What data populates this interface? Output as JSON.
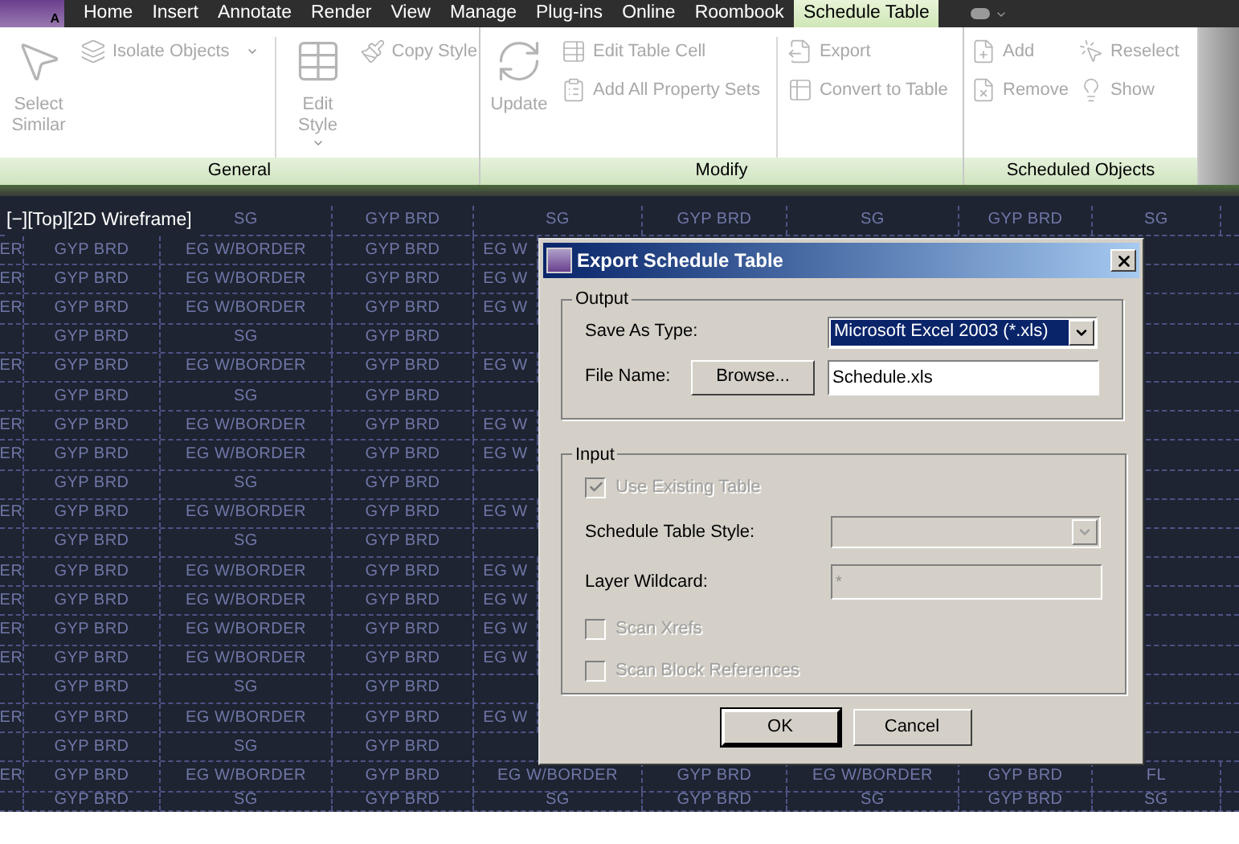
{
  "app_button": {
    "letter": "A"
  },
  "tabs": [
    {
      "label": "Home",
      "selected": false
    },
    {
      "label": "Insert",
      "selected": false
    },
    {
      "label": "Annotate",
      "selected": false
    },
    {
      "label": "Render",
      "selected": false
    },
    {
      "label": "View",
      "selected": false
    },
    {
      "label": "Manage",
      "selected": false
    },
    {
      "label": "Plug-ins",
      "selected": false
    },
    {
      "label": "Online",
      "selected": false
    },
    {
      "label": "Roombook",
      "selected": false
    },
    {
      "label": "Schedule Table",
      "selected": true
    }
  ],
  "ribbon": {
    "panels": [
      {
        "title": "General",
        "groups": [
          {
            "kind": "large",
            "separator_after": false,
            "items": [
              {
                "label": "Select Similar",
                "dropdown": false,
                "disabled": true
              }
            ]
          },
          {
            "kind": "small",
            "separator_after": true,
            "items": [
              {
                "label": "Isolate Objects",
                "dropdown": true,
                "disabled": true
              }
            ]
          },
          {
            "kind": "large",
            "separator_after": false,
            "items": [
              {
                "label": "Edit Style",
                "dropdown": true,
                "disabled": true
              }
            ]
          },
          {
            "kind": "small",
            "separator_after": false,
            "items": [
              {
                "label": "Copy Style",
                "dropdown": false,
                "disabled": true
              }
            ]
          }
        ]
      },
      {
        "title": "Modify",
        "groups": [
          {
            "kind": "large",
            "separator_after": false,
            "items": [
              {
                "label": "Update",
                "dropdown": false,
                "disabled": true
              }
            ]
          },
          {
            "kind": "small",
            "separator_after": true,
            "items": [
              {
                "label": "Edit Table Cell",
                "dropdown": false,
                "disabled": true
              },
              {
                "label": "Add All Property Sets",
                "dropdown": false,
                "disabled": true
              }
            ]
          },
          {
            "kind": "small",
            "separator_after": false,
            "items": [
              {
                "label": "Export",
                "dropdown": false,
                "disabled": true
              },
              {
                "label": "Convert to Table",
                "dropdown": false,
                "disabled": true
              }
            ]
          }
        ]
      },
      {
        "title": "Scheduled Objects",
        "groups": [
          {
            "kind": "small",
            "separator_after": false,
            "items": [
              {
                "label": "Add",
                "dropdown": false,
                "disabled": true
              },
              {
                "label": "Remove",
                "dropdown": false,
                "disabled": true
              }
            ]
          },
          {
            "kind": "small",
            "separator_after": false,
            "items": [
              {
                "label": "Reselect",
                "dropdown": false,
                "disabled": true
              },
              {
                "label": "Show",
                "dropdown": false,
                "disabled": true
              }
            ]
          }
        ]
      }
    ]
  },
  "viewport": {
    "label": "[−][Top][2D Wireframe]",
    "rows": [
      {
        "kind": "full",
        "cells": [
          "",
          "",
          "SG",
          "GYP BRD",
          "SG",
          "GYP BRD",
          "SG",
          "GYP BRD",
          "SG"
        ]
      },
      {
        "kind": "left",
        "cells": [
          "ER",
          "GYP BRD",
          "EG W/BORDER",
          "GYP BRD",
          "EG W"
        ]
      },
      {
        "kind": "left",
        "cells": [
          "ER",
          "GYP BRD",
          "EG W/BORDER",
          "GYP BRD",
          "EG W"
        ]
      },
      {
        "kind": "left",
        "cells": [
          "ER",
          "GYP BRD",
          "EG W/BORDER",
          "GYP BRD",
          "EG W"
        ]
      },
      {
        "kind": "left",
        "cells": [
          "",
          "GYP BRD",
          "SG",
          "GYP BRD"
        ]
      },
      {
        "kind": "left",
        "cells": [
          "ER",
          "GYP BRD",
          "EG W/BORDER",
          "GYP BRD",
          "EG W"
        ]
      },
      {
        "kind": "left",
        "cells": [
          "",
          "GYP BRD",
          "SG",
          "GYP BRD"
        ]
      },
      {
        "kind": "left",
        "cells": [
          "ER",
          "GYP BRD",
          "EG W/BORDER",
          "GYP BRD",
          "EG W"
        ]
      },
      {
        "kind": "left",
        "cells": [
          "ER",
          "GYP BRD",
          "EG W/BORDER",
          "GYP BRD",
          "EG W"
        ]
      },
      {
        "kind": "left",
        "cells": [
          "",
          "GYP BRD",
          "SG",
          "GYP BRD"
        ]
      },
      {
        "kind": "left",
        "cells": [
          "ER",
          "GYP BRD",
          "EG W/BORDER",
          "GYP BRD",
          "EG W"
        ]
      },
      {
        "kind": "left",
        "cells": [
          "",
          "GYP BRD",
          "SG",
          "GYP BRD"
        ]
      },
      {
        "kind": "left",
        "cells": [
          "ER",
          "GYP BRD",
          "EG W/BORDER",
          "GYP BRD",
          "EG W"
        ]
      },
      {
        "kind": "left",
        "cells": [
          "ER",
          "GYP BRD",
          "EG W/BORDER",
          "GYP BRD",
          "EG W"
        ]
      },
      {
        "kind": "left",
        "cells": [
          "ER",
          "GYP BRD",
          "EG W/BORDER",
          "GYP BRD",
          "EG W"
        ]
      },
      {
        "kind": "left",
        "cells": [
          "ER",
          "GYP BRD",
          "EG W/BORDER",
          "GYP BRD",
          "EG W"
        ]
      },
      {
        "kind": "left",
        "cells": [
          "",
          "GYP BRD",
          "SG",
          "GYP BRD"
        ]
      },
      {
        "kind": "left",
        "cells": [
          "ER",
          "GYP BRD",
          "EG W/BORDER",
          "GYP BRD",
          "EG W"
        ]
      },
      {
        "kind": "left",
        "cells": [
          "",
          "GYP BRD",
          "SG",
          "GYP BRD"
        ]
      },
      {
        "kind": "full",
        "cells": [
          "ER",
          "GYP BRD",
          "EG W/BORDER",
          "GYP BRD",
          "EG W/BORDER",
          "GYP BRD",
          "EG W/BORDER",
          "GYP BRD",
          "FL"
        ]
      },
      {
        "kind": "full",
        "cells": [
          "",
          "GYP BRD",
          "SG",
          "GYP BRD",
          "SG",
          "GYP BRD",
          "SG",
          "GYP BRD",
          "SG"
        ]
      }
    ]
  },
  "dialog": {
    "title": "Export Schedule Table",
    "output": {
      "title": "Output",
      "save_as_label": "Save As Type:",
      "save_as_value": "Microsoft Excel 2003 (*.xls)",
      "file_name_label": "File Name:",
      "browse": "Browse...",
      "file_name_value": "Schedule.xls"
    },
    "input": {
      "title": "Input",
      "use_existing": {
        "label": "Use Existing Table",
        "checked": true,
        "disabled": true
      },
      "style_label": "Schedule Table Style:",
      "style_disabled": true,
      "layer_label": "Layer Wildcard:",
      "layer_value": "*",
      "layer_disabled": true,
      "scan_xrefs": {
        "label": "Scan Xrefs",
        "checked": false,
        "disabled": true
      },
      "scan_blocks": {
        "label": "Scan Block References",
        "checked": false,
        "disabled": true
      }
    },
    "buttons": [
      {
        "label": "OK",
        "default": true
      },
      {
        "label": "Cancel",
        "default": false
      }
    ]
  }
}
